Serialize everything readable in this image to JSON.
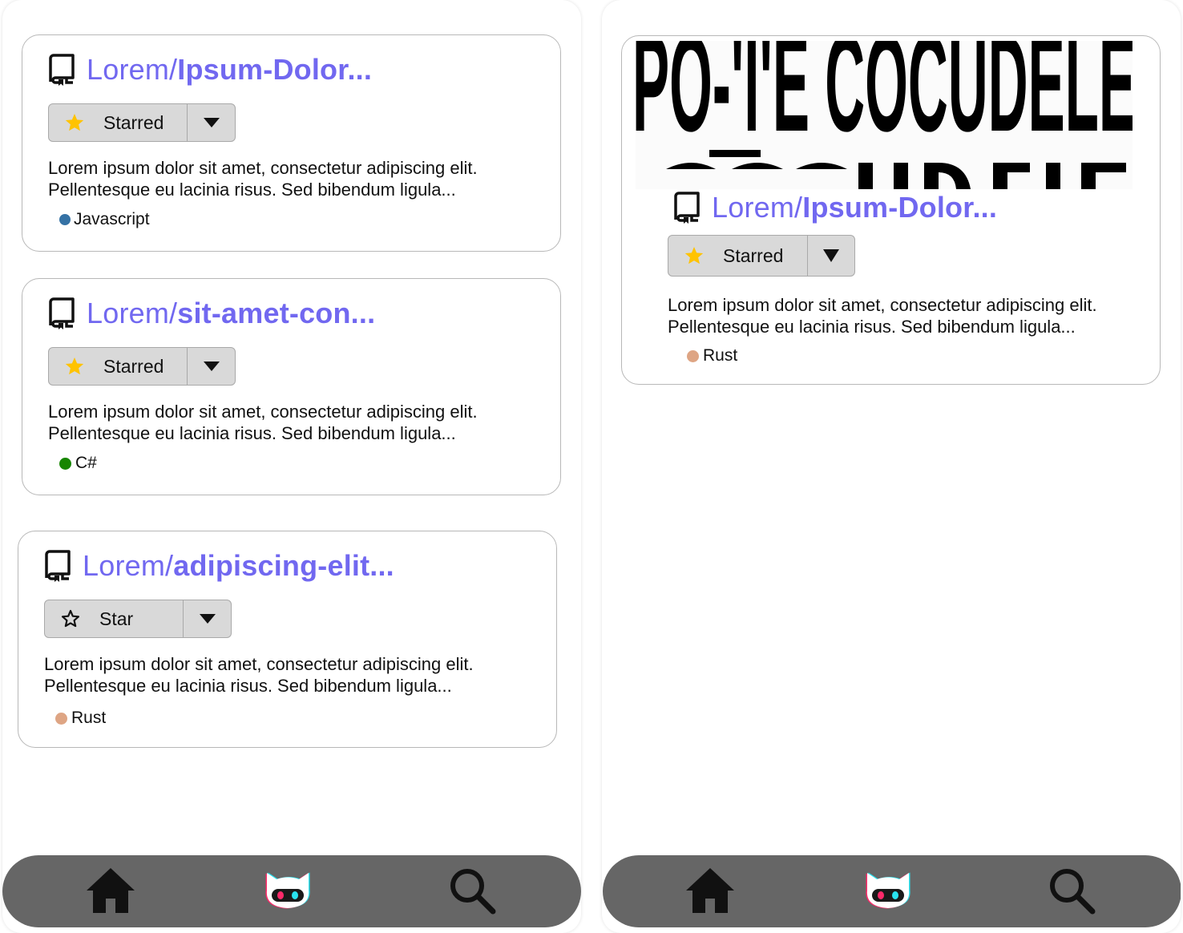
{
  "colors": {
    "accent": "#7168f0",
    "star_filled": "#ffc300",
    "button_bg": "#d9d9d9",
    "navbar_bg": "#666666",
    "javascript": "#3572a5",
    "csharp": "#178600",
    "rust": "#dea584"
  },
  "left_screen": {
    "cards": [
      {
        "owner": "Lorem/",
        "repo": "Ipsum-Dolor...",
        "star_label": "Starred",
        "star_state": "filled",
        "description": "Lorem ipsum dolor sit amet, consectetur adipiscing elit. Pellentesque eu lacinia risus. Sed bibendum ligula...",
        "language": "Javascript"
      },
      {
        "owner": "Lorem/",
        "repo": "sit-amet-con...",
        "star_label": "Starred",
        "star_state": "filled",
        "description": "Lorem ipsum dolor sit amet, consectetur adipiscing elit. Pellentesque eu lacinia risus. Sed bibendum ligula...",
        "language": "C#"
      },
      {
        "owner": "Lorem/",
        "repo": "adipiscing-elit...",
        "star_label": "Star",
        "star_state": "outline",
        "description": "Lorem ipsum dolor sit amet, consectetur adipiscing elit. Pellentesque eu lacinia risus. Sed bibendum ligula...",
        "language": "Rust"
      }
    ]
  },
  "right_screen": {
    "banner_text": "PO-'I'E CÔCUDELE",
    "card": {
      "owner": "Lorem/",
      "repo": "Ipsum-Dolor...",
      "star_label": "Starred",
      "star_state": "filled",
      "description": "Lorem ipsum dolor sit amet, consectetur adipiscing elit. Pellentesque eu lacinia risus. Sed bibendum ligula...",
      "language": "Rust"
    }
  },
  "navbar": {
    "items": [
      "home-icon",
      "octocat-icon",
      "search-icon"
    ]
  }
}
